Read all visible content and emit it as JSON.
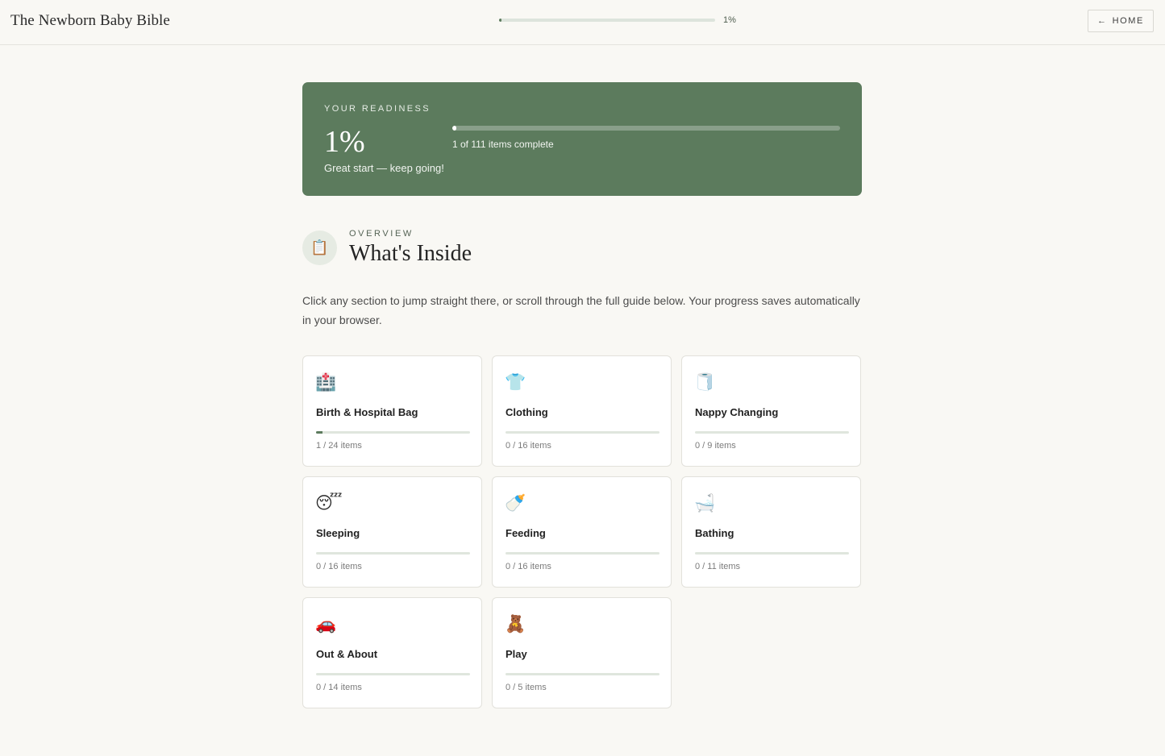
{
  "header": {
    "brand": "The Newborn Baby Bible",
    "progress_label": "1%",
    "progress": 0.01,
    "home_label": "HOME",
    "home_icon": "arrow-left-icon"
  },
  "readiness": {
    "eyebrow": "YOUR READINESS",
    "percent": "1%",
    "message": "Great start — keep going!",
    "progress": 0.01,
    "count_text": "1 of 111 items complete"
  },
  "overview": {
    "icon": "clipboard-icon",
    "eyebrow": "OVERVIEW",
    "title": "What's Inside",
    "intro": "Click any section to jump straight there, or scroll through the full guide below. Your progress saves automatically in your browser."
  },
  "sections": [
    {
      "icon": "hospital-icon",
      "glyph": "🏥",
      "name": "Birth & Hospital Bag",
      "done": 1,
      "total": 24,
      "count": "1 / 24 items"
    },
    {
      "icon": "shirt-icon",
      "glyph": "👕",
      "name": "Clothing",
      "done": 0,
      "total": 16,
      "count": "0 / 16 items"
    },
    {
      "icon": "roll-icon",
      "glyph": "🧻",
      "name": "Nappy Changing",
      "done": 0,
      "total": 9,
      "count": "0 / 9 items"
    },
    {
      "icon": "sleeping-face-icon",
      "glyph": "😴",
      "name": "Sleeping",
      "done": 0,
      "total": 16,
      "count": "0 / 16 items"
    },
    {
      "icon": "baby-bottle-icon",
      "glyph": "🍼",
      "name": "Feeding",
      "done": 0,
      "total": 16,
      "count": "0 / 16 items"
    },
    {
      "icon": "bathtub-icon",
      "glyph": "🛁",
      "name": "Bathing",
      "done": 0,
      "total": 11,
      "count": "0 / 11 items"
    },
    {
      "icon": "car-icon",
      "glyph": "🚗",
      "name": "Out & About",
      "done": 0,
      "total": 14,
      "count": "0 / 14 items"
    },
    {
      "icon": "teddy-bear-icon",
      "glyph": "🧸",
      "name": "Play",
      "done": 0,
      "total": 5,
      "count": "0 / 5 items"
    }
  ]
}
